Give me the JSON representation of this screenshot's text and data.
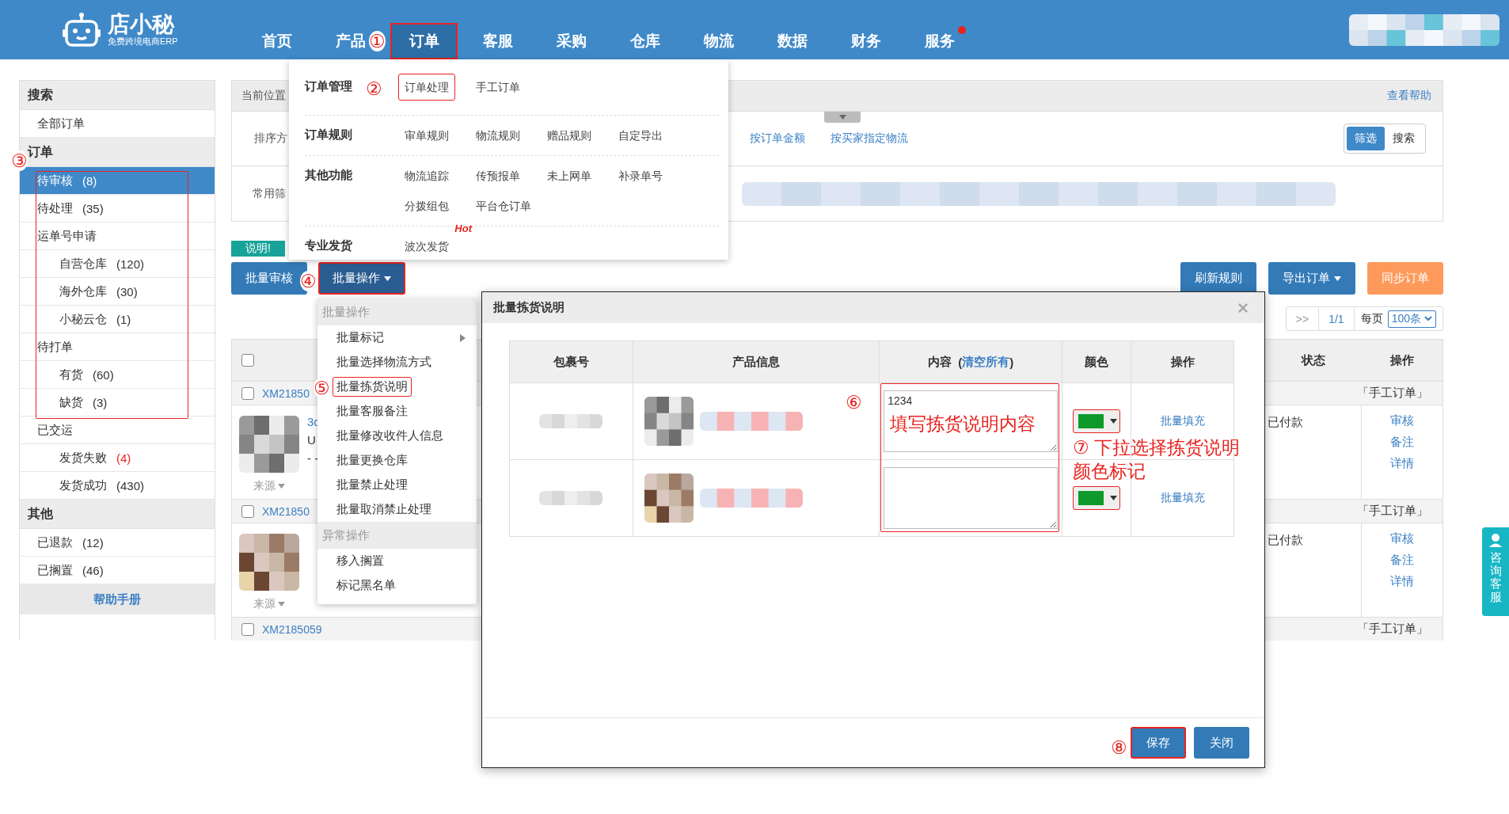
{
  "header": {
    "logo": {
      "name": "店小秘",
      "tagline": "免费跨境电商ERP"
    },
    "nav": [
      {
        "label": "首页",
        "selected": false,
        "outlined": false
      },
      {
        "label": "产品",
        "selected": false,
        "outlined": false
      },
      {
        "label": "订单",
        "selected": true,
        "outlined": true
      },
      {
        "label": "客服",
        "selected": false,
        "outlined": false
      },
      {
        "label": "采购",
        "selected": false,
        "outlined": false
      },
      {
        "label": "仓库",
        "selected": false,
        "outlined": false
      },
      {
        "label": "物流",
        "selected": false,
        "outlined": false
      },
      {
        "label": "数据",
        "selected": false,
        "outlined": false
      },
      {
        "label": "财务",
        "selected": false,
        "outlined": false
      },
      {
        "label": "服务",
        "selected": false,
        "outlined": false,
        "notification": true
      }
    ]
  },
  "nav_menu": {
    "groups": [
      {
        "title": "订单管理",
        "items": [
          {
            "label": "订单处理",
            "outlined": true
          },
          {
            "label": "手工订单",
            "outlined": false
          }
        ]
      },
      {
        "title": "订单规则",
        "items": [
          {
            "label": "审单规则",
            "outlined": false
          },
          {
            "label": "物流规则",
            "outlined": false
          },
          {
            "label": "赠品规则",
            "outlined": false
          },
          {
            "label": "自定导出",
            "outlined": false
          }
        ]
      },
      {
        "title": "其他功能",
        "items": [
          {
            "label": "物流追踪",
            "outlined": false
          },
          {
            "label": "传预报单",
            "outlined": false
          },
          {
            "label": "未上网单",
            "outlined": false
          },
          {
            "label": "补录单号",
            "outlined": false
          },
          {
            "label": "分拨组包",
            "outlined": false
          },
          {
            "label": "平台仓订单",
            "outlined": false
          }
        ]
      },
      {
        "title": "专业发货",
        "items": [
          {
            "label": "波次发货",
            "outlined": false,
            "tag": "Hot"
          }
        ]
      }
    ]
  },
  "sidebar": {
    "sections": [
      {
        "title": "搜索",
        "items": [
          {
            "label": "全部订单",
            "selected": false
          }
        ]
      },
      {
        "title": "订单",
        "items": [
          {
            "label": "待审核",
            "count": "(8)",
            "selected": true
          },
          {
            "label": "待处理",
            "count": "(35)",
            "selected": false
          },
          {
            "label": "运单号申请",
            "selected": false,
            "children": [
              {
                "label": "自营仓库",
                "count": "(120)",
                "selected": false
              },
              {
                "label": "海外仓库",
                "count": "(30)",
                "selected": false
              },
              {
                "label": "小秘云仓",
                "count": "(1)",
                "selected": false
              }
            ]
          },
          {
            "label": "待打单",
            "selected": false,
            "children": [
              {
                "label": "有货",
                "count": "(60)",
                "selected": false
              },
              {
                "label": "缺货",
                "count": "(3)",
                "selected": false
              }
            ]
          },
          {
            "label": "已交运",
            "selected": false,
            "children": [
              {
                "label": "发货失败",
                "count": "(4)",
                "selected": false,
                "alert": true
              },
              {
                "label": "发货成功",
                "count": "(430)",
                "selected": false,
                "alert": false
              }
            ]
          }
        ]
      },
      {
        "title": "其他",
        "items": [
          {
            "label": "已退款",
            "count": "(12)",
            "selected": false
          },
          {
            "label": "已搁置",
            "count": "(46)",
            "selected": false
          }
        ]
      }
    ],
    "help": "帮助手册"
  },
  "breadcrumb": {
    "label": "当前位置",
    "help_link": "查看帮助"
  },
  "filters": {
    "sort_label": "排序方",
    "sort_options": [
      "按订单金额",
      "按买家指定物流"
    ],
    "mode_tabs": [
      {
        "label": "筛选",
        "selected": true
      },
      {
        "label": "搜索",
        "selected": false
      }
    ],
    "common_label": "常用筛"
  },
  "notice_badge": "说明!",
  "toolbar": {
    "left": [
      {
        "label": "批量审核",
        "kind": "primary",
        "dropdown": false,
        "outlined": false
      },
      {
        "label": "批量操作",
        "kind": "dark",
        "dropdown": true,
        "outlined": true
      }
    ],
    "right": [
      {
        "label": "刷新规则",
        "kind": "primary",
        "dropdown": false,
        "outlined": false
      },
      {
        "label": "导出订单",
        "kind": "primary",
        "dropdown": true,
        "outlined": false
      },
      {
        "label": "同步订单",
        "kind": "warning",
        "dropdown": false,
        "outlined": false
      }
    ]
  },
  "pager": {
    "next": ">>",
    "page": "1/1",
    "per_page_label": "每页",
    "per_page": "100条"
  },
  "orders_table": {
    "header_checked": false,
    "columns": {
      "status": "状态",
      "actions": "操作"
    },
    "rows": [
      {
        "checked": false,
        "order_no": "XM21850",
        "type": "「手工订单」",
        "lines": [
          "3c",
          "U",
          "- -"
        ],
        "source": "来源",
        "status": "已付款",
        "actions": [
          "审核",
          "备注",
          "详情"
        ]
      },
      {
        "checked": false,
        "order_no": "XM21850",
        "type": "「手工订单」",
        "source": "来源",
        "status": "已付款",
        "actions": [
          "审核",
          "备注",
          "详情"
        ]
      },
      {
        "checked": false,
        "order_no": "XM2185059",
        "type": "「手工订单」"
      }
    ]
  },
  "batch_menu": {
    "sections": [
      {
        "header": "批量操作",
        "items": [
          {
            "label": "批量标记",
            "submenu": true,
            "outlined": false
          },
          {
            "label": "批量选择物流方式",
            "submenu": false,
            "outlined": false
          },
          {
            "label": "批量拣货说明",
            "submenu": false,
            "outlined": true
          },
          {
            "label": "批量客服备注",
            "submenu": false,
            "outlined": false
          },
          {
            "label": "批量修改收件人信息",
            "submenu": false,
            "outlined": false
          },
          {
            "label": "批量更换仓库",
            "submenu": false,
            "outlined": false
          },
          {
            "label": "批量禁止处理",
            "submenu": false,
            "outlined": false
          },
          {
            "label": "批量取消禁止处理",
            "submenu": false,
            "outlined": false
          }
        ]
      },
      {
        "header": "异常操作",
        "items": [
          {
            "label": "移入搁置",
            "submenu": false,
            "outlined": false
          },
          {
            "label": "标记黑名单",
            "submenu": false,
            "outlined": false
          }
        ]
      }
    ]
  },
  "modal": {
    "title": "批量拣货说明",
    "close": "×",
    "columns": [
      {
        "kind": "text",
        "label": "包裹号"
      },
      {
        "kind": "text",
        "label": "产品信息"
      },
      {
        "kind": "content",
        "label": "内容",
        "open": "(",
        "link": "清空所有",
        "close": ")"
      },
      {
        "kind": "text",
        "label": "颜色"
      },
      {
        "kind": "text",
        "label": "操作"
      }
    ],
    "rows": [
      {
        "content": "1234",
        "color": "#0e9a2b",
        "color_outlined": true,
        "action": "批量填充"
      },
      {
        "color": "#0e9a2b",
        "color_outlined": true,
        "action": "批量填充"
      }
    ],
    "buttons": [
      {
        "label": "保存",
        "kind": "primary",
        "outlined": true
      },
      {
        "label": "关闭",
        "kind": "primary",
        "outlined": false
      }
    ]
  },
  "annotations": [
    {
      "mark": "①"
    },
    {
      "mark": "②"
    },
    {
      "mark": "③"
    },
    {
      "mark": "④"
    },
    {
      "mark": "⑤"
    },
    {
      "mark": "⑥"
    },
    {
      "text": "填写拣货说明内容"
    },
    {
      "mark": "⑦",
      "text": "下拉选择拣货说明颜色标记"
    },
    {
      "mark": "⑧"
    }
  ],
  "support_widget": {
    "label": "咨询客服"
  }
}
